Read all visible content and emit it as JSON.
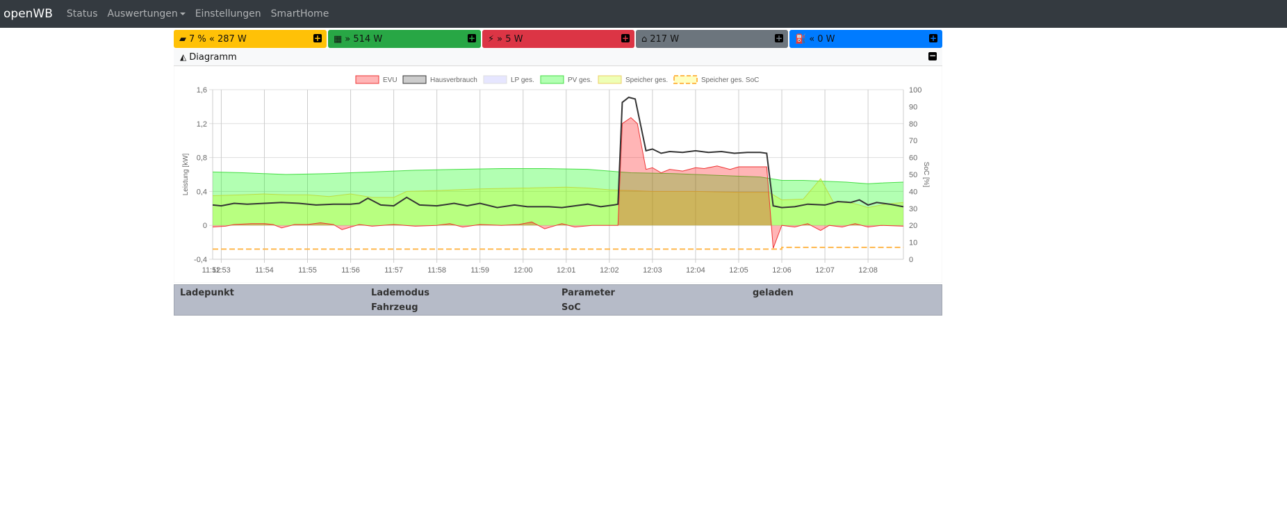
{
  "nav": {
    "brand": "openWB",
    "items": [
      "Status",
      "Auswertungen",
      "Einstellungen",
      "SmartHome"
    ]
  },
  "boxes": [
    {
      "icon": "battery-icon",
      "text": "7 % « 287 W",
      "color": "#ffc107"
    },
    {
      "icon": "solar-panel-icon",
      "text": "» 514 W",
      "color": "#28a745"
    },
    {
      "icon": "power-tower-icon",
      "text": "» 5 W",
      "color": "#dc3545"
    },
    {
      "icon": "home-icon",
      "text": "217 W",
      "color": "#6c757d"
    },
    {
      "icon": "charging-station-icon",
      "text": "« 0 W",
      "color": "#007bff"
    }
  ],
  "diagram": {
    "title": "Diagramm"
  },
  "chart_data": {
    "type": "area",
    "x_unit": "minutes after 11:52",
    "xlim": [
      0.8,
      16.82
    ],
    "xticks": [
      "11:52",
      "11:53",
      "11:54",
      "11:55",
      "11:56",
      "11:57",
      "11:58",
      "11:59",
      "12:00",
      "12:01",
      "12:02",
      "12:03",
      "12:04",
      "12:05",
      "12:06",
      "12:07",
      "12:08"
    ],
    "ylabel": "Leistung [kW]",
    "ylim": [
      -0.4,
      1.6
    ],
    "yticks": [
      "-0,4",
      "0",
      "0,4",
      "0,8",
      "1,2",
      "1,6"
    ],
    "y2label": "SoC [%]",
    "y2lim": [
      0,
      100
    ],
    "y2ticks": [
      "0",
      "10",
      "20",
      "30",
      "40",
      "50",
      "60",
      "70",
      "80",
      "90",
      "100"
    ],
    "legend": [
      "EVU",
      "Hausverbrauch",
      "LP ges.",
      "PV ges.",
      "Speicher ges.",
      "Speicher ges. SoC"
    ],
    "series": {
      "pv": [
        [
          0.8,
          0.63
        ],
        [
          1.5,
          0.62
        ],
        [
          2.5,
          0.6
        ],
        [
          3.5,
          0.61
        ],
        [
          4.5,
          0.63
        ],
        [
          5.5,
          0.65
        ],
        [
          6.5,
          0.66
        ],
        [
          7.5,
          0.67
        ],
        [
          8.5,
          0.67
        ],
        [
          9.5,
          0.66
        ],
        [
          10.5,
          0.62
        ],
        [
          11.5,
          0.61
        ],
        [
          12.5,
          0.59
        ],
        [
          13.5,
          0.57
        ],
        [
          14.0,
          0.53
        ],
        [
          14.5,
          0.53
        ],
        [
          15.0,
          0.52
        ],
        [
          15.5,
          0.51
        ],
        [
          16.0,
          0.49
        ],
        [
          16.3,
          0.5
        ],
        [
          16.82,
          0.51
        ]
      ],
      "speicher": [
        [
          0.8,
          0.35
        ],
        [
          1.5,
          0.36
        ],
        [
          2.0,
          0.37
        ],
        [
          2.5,
          0.36
        ],
        [
          3.0,
          0.36
        ],
        [
          3.5,
          0.34
        ],
        [
          4.0,
          0.37
        ],
        [
          4.5,
          0.33
        ],
        [
          5.0,
          0.33
        ],
        [
          5.3,
          0.4
        ],
        [
          6.0,
          0.41
        ],
        [
          7.0,
          0.43
        ],
        [
          8.0,
          0.44
        ],
        [
          9.0,
          0.45
        ],
        [
          9.5,
          0.44
        ],
        [
          10.0,
          0.42
        ],
        [
          10.5,
          0.41
        ],
        [
          11.0,
          0.4
        ],
        [
          12.0,
          0.4
        ],
        [
          13.0,
          0.39
        ],
        [
          13.7,
          0.39
        ],
        [
          14.0,
          0.3
        ],
        [
          14.5,
          0.31
        ],
        [
          14.9,
          0.55
        ],
        [
          15.2,
          0.27
        ],
        [
          15.5,
          0.28
        ],
        [
          15.8,
          0.24
        ],
        [
          16.0,
          0.21
        ],
        [
          16.4,
          0.25
        ],
        [
          16.82,
          0.27
        ]
      ],
      "evu": [
        [
          0.8,
          -0.02
        ],
        [
          1.1,
          -0.01
        ],
        [
          1.3,
          0.01
        ],
        [
          1.7,
          0.02
        ],
        [
          2.0,
          0.02
        ],
        [
          2.2,
          0.01
        ],
        [
          2.4,
          -0.03
        ],
        [
          2.7,
          0.01
        ],
        [
          3.0,
          0.01
        ],
        [
          3.3,
          0.03
        ],
        [
          3.6,
          0.01
        ],
        [
          3.8,
          -0.05
        ],
        [
          4.2,
          0.01
        ],
        [
          4.5,
          -0.01
        ],
        [
          5.0,
          0.01
        ],
        [
          5.5,
          -0.01
        ],
        [
          6.0,
          0
        ],
        [
          6.3,
          0.02
        ],
        [
          6.6,
          -0.02
        ],
        [
          7.0,
          0.01
        ],
        [
          7.5,
          0
        ],
        [
          7.9,
          0.01
        ],
        [
          8.2,
          0.04
        ],
        [
          8.5,
          -0.04
        ],
        [
          8.9,
          0.02
        ],
        [
          9.2,
          -0.02
        ],
        [
          9.6,
          0
        ],
        [
          10.2,
          0
        ],
        [
          10.3,
          1.2
        ],
        [
          10.5,
          1.27
        ],
        [
          10.65,
          1.2
        ],
        [
          10.85,
          0.66
        ],
        [
          11.0,
          0.68
        ],
        [
          11.2,
          0.62
        ],
        [
          11.4,
          0.66
        ],
        [
          11.7,
          0.64
        ],
        [
          12.0,
          0.68
        ],
        [
          12.2,
          0.67
        ],
        [
          12.5,
          0.7
        ],
        [
          12.8,
          0.66
        ],
        [
          13.0,
          0.69
        ],
        [
          13.65,
          0.69
        ],
        [
          13.8,
          -0.27
        ],
        [
          14.0,
          0
        ],
        [
          14.3,
          -0.02
        ],
        [
          14.6,
          0.02
        ],
        [
          14.9,
          -0.06
        ],
        [
          15.1,
          0
        ],
        [
          15.4,
          -0.02
        ],
        [
          15.7,
          0.02
        ],
        [
          16.0,
          -0.02
        ],
        [
          16.3,
          0
        ],
        [
          16.82,
          -0.01
        ]
      ],
      "haus": [
        [
          0.8,
          0.24
        ],
        [
          1.0,
          0.23
        ],
        [
          1.3,
          0.26
        ],
        [
          1.6,
          0.25
        ],
        [
          2.0,
          0.26
        ],
        [
          2.4,
          0.27
        ],
        [
          2.8,
          0.26
        ],
        [
          3.2,
          0.24
        ],
        [
          3.6,
          0.25
        ],
        [
          4.0,
          0.25
        ],
        [
          4.2,
          0.26
        ],
        [
          4.4,
          0.32
        ],
        [
          4.7,
          0.24
        ],
        [
          5.0,
          0.23
        ],
        [
          5.3,
          0.33
        ],
        [
          5.6,
          0.24
        ],
        [
          6.0,
          0.23
        ],
        [
          6.4,
          0.26
        ],
        [
          6.7,
          0.23
        ],
        [
          7.0,
          0.26
        ],
        [
          7.4,
          0.21
        ],
        [
          7.8,
          0.24
        ],
        [
          8.1,
          0.22
        ],
        [
          8.6,
          0.22
        ],
        [
          8.9,
          0.21
        ],
        [
          9.2,
          0.23
        ],
        [
          9.5,
          0.25
        ],
        [
          9.8,
          0.22
        ],
        [
          10.1,
          0.24
        ],
        [
          10.2,
          0.25
        ],
        [
          10.3,
          1.45
        ],
        [
          10.45,
          1.51
        ],
        [
          10.6,
          1.49
        ],
        [
          10.85,
          0.88
        ],
        [
          11.0,
          0.9
        ],
        [
          11.2,
          0.85
        ],
        [
          11.4,
          0.87
        ],
        [
          11.7,
          0.86
        ],
        [
          12.0,
          0.88
        ],
        [
          12.3,
          0.86
        ],
        [
          12.6,
          0.87
        ],
        [
          12.9,
          0.85
        ],
        [
          13.2,
          0.86
        ],
        [
          13.5,
          0.86
        ],
        [
          13.65,
          0.85
        ],
        [
          13.8,
          0.23
        ],
        [
          14.0,
          0.21
        ],
        [
          14.3,
          0.22
        ],
        [
          14.6,
          0.25
        ],
        [
          15.0,
          0.24
        ],
        [
          15.3,
          0.28
        ],
        [
          15.6,
          0.27
        ],
        [
          15.8,
          0.3
        ],
        [
          16.0,
          0.24
        ],
        [
          16.2,
          0.27
        ],
        [
          16.5,
          0.25
        ],
        [
          16.82,
          0.22
        ]
      ],
      "soc": [
        [
          0.8,
          6
        ],
        [
          14.0,
          6
        ],
        [
          14.0,
          7
        ],
        [
          16.82,
          7
        ]
      ]
    }
  },
  "table": {
    "headers": [
      "Ladepunkt",
      "Lademodus",
      "Fahrzeug",
      "Parameter",
      "SoC",
      "geladen"
    ]
  }
}
